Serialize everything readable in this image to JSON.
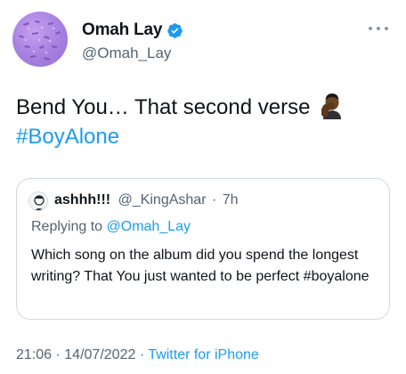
{
  "author": {
    "display_name": "Omah Lay",
    "handle": "@Omah_Lay",
    "verified": true,
    "avatar_icon": "purple-pattern-avatar"
  },
  "tweet": {
    "text": "Bend You… That second verse",
    "emoji": "man-facepalming-dark-skin-tone",
    "hashtag": "#BoyAlone"
  },
  "quoted_tweet": {
    "display_name": "ashhh!!!",
    "handle": "@_KingAshar",
    "separator": "·",
    "time": "7h",
    "replying_prefix": "Replying to",
    "replying_to": "@Omah_Lay",
    "body": "Which song on the album did you spend the longest writing? That You just wanted to be perfect #boyalone"
  },
  "meta": {
    "time": "21:06",
    "sep1": "·",
    "date": "14/07/2022",
    "sep2": "·",
    "source": "Twitter for iPhone"
  },
  "colors": {
    "link": "#1d9bf0",
    "secondary_text": "#536471",
    "border": "#cfd9de"
  }
}
